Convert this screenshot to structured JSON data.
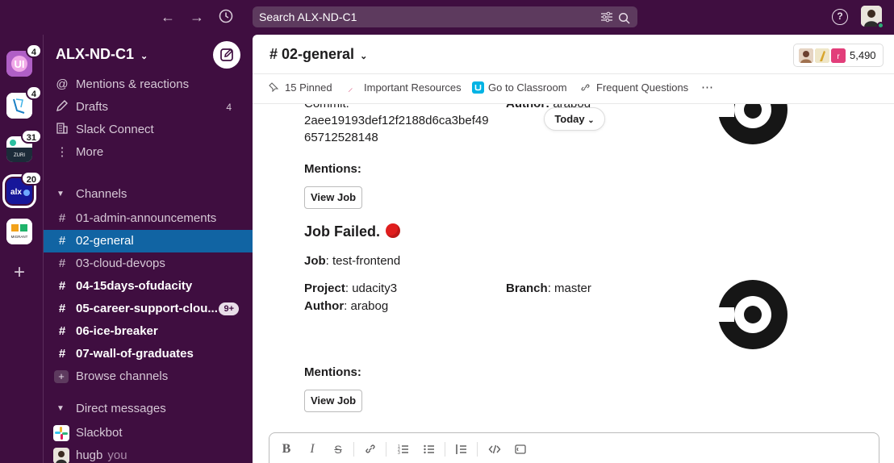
{
  "topbar": {
    "back_icon": "arrow-left-icon",
    "forward_icon": "arrow-right-icon",
    "history_icon": "clock-icon",
    "search_placeholder": "Search ALX-ND-C1",
    "help_label": "?"
  },
  "workspaces": [
    {
      "label": "UI",
      "badge": "4",
      "color": "#c26fd1"
    },
    {
      "label": "",
      "badge": "4",
      "color": "#ffffff"
    },
    {
      "label": "ZURI",
      "badge": "31",
      "color": "#1c2b39"
    },
    {
      "label": "alx",
      "badge": "20",
      "color": "#1a1aa6"
    },
    {
      "label": "MIGRANT",
      "badge": "",
      "color": "#ffffff"
    }
  ],
  "sidebar": {
    "workspace_name": "ALX-ND-C1",
    "top_items": [
      {
        "icon": "at-icon",
        "label": "Mentions & reactions",
        "count": ""
      },
      {
        "icon": "pencil-icon",
        "label": "Drafts",
        "count": "4"
      },
      {
        "icon": "building-icon",
        "label": "Slack Connect",
        "count": ""
      },
      {
        "icon": "more-vertical-icon",
        "label": "More",
        "count": ""
      }
    ],
    "channels_header": "Channels",
    "channels": [
      {
        "label": "01-admin-announcements",
        "bold": false,
        "selected": false,
        "pill": ""
      },
      {
        "label": "02-general",
        "bold": false,
        "selected": true,
        "pill": ""
      },
      {
        "label": "03-cloud-devops",
        "bold": false,
        "selected": false,
        "pill": ""
      },
      {
        "label": "04-15days-ofudacity",
        "bold": true,
        "selected": false,
        "pill": ""
      },
      {
        "label": "05-career-support-clou...",
        "bold": true,
        "selected": false,
        "pill": "9+"
      },
      {
        "label": "06-ice-breaker",
        "bold": true,
        "selected": false,
        "pill": ""
      },
      {
        "label": "07-wall-of-graduates",
        "bold": true,
        "selected": false,
        "pill": ""
      }
    ],
    "browse_channels": "Browse channels",
    "dm_header": "Direct messages",
    "dms": [
      {
        "label": "Slackbot",
        "suffix": ""
      },
      {
        "label": "hugb",
        "suffix": "you"
      }
    ]
  },
  "channel": {
    "title": "# 02-general",
    "member_count": "5,490",
    "bookmarks": [
      {
        "icon": "pin-icon",
        "label": "15 Pinned"
      },
      {
        "icon": "bookmark-icon",
        "label": "Important Resources"
      },
      {
        "icon": "udacity-icon",
        "label": "Go to Classroom"
      },
      {
        "icon": "link-icon",
        "label": "Frequent Questions"
      }
    ],
    "bookmarks_more": "⋯",
    "today_label": "Today"
  },
  "messages": {
    "first": {
      "commit_label": "Commit:",
      "commit_hash_line1": "2aee19193def12f2188d6ca3bef49",
      "commit_hash_line2": "65712528148",
      "author_label": "Author:",
      "author_value": "arabog",
      "mentions_label": "Mentions:",
      "view_job": "View Job"
    },
    "second": {
      "title": "Job Failed.",
      "job_label": "Job",
      "job_value": ": test-frontend",
      "project_label": "Project",
      "project_value": ": udacity3",
      "branch_label": "Branch",
      "branch_value": ": master",
      "author_label": "Author",
      "author_value": ": arabog",
      "mentions_label": "Mentions:",
      "view_job": "View Job"
    }
  },
  "composer": {
    "tools": [
      "B",
      "I",
      "S"
    ]
  },
  "colors": {
    "aubergine": "#3f0e40",
    "selected": "#1164a3",
    "failed_red": "#e01e1e"
  }
}
